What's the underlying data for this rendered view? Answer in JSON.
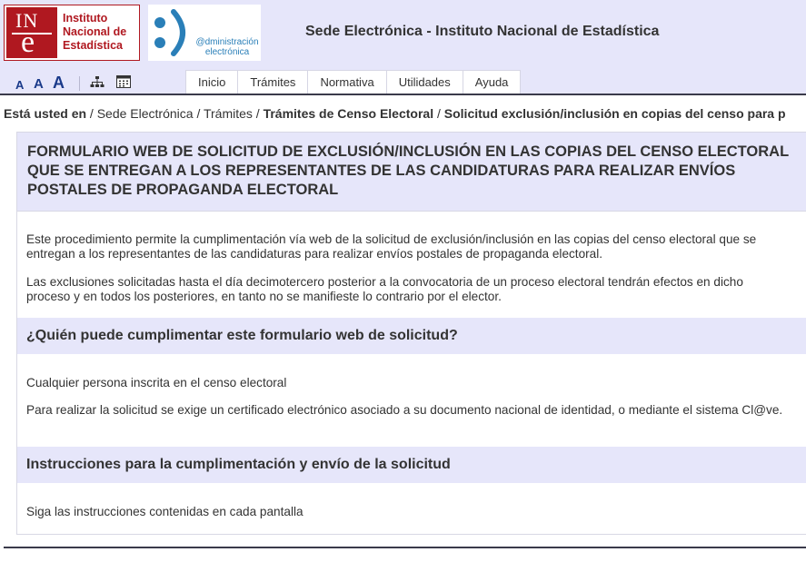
{
  "header": {
    "ine_logo": {
      "mark": "INE",
      "lines": [
        "Instituto",
        "Nacional de",
        "Estadística"
      ],
      "brand_color": "#b01820"
    },
    "admin_logo": {
      "lines": [
        "@dministración",
        "electrónica"
      ],
      "brand_color": "#2a7fb8"
    },
    "site_title": "Sede Electrónica - Instituto Nacional de Estadística",
    "font_sizes": {
      "small": "A",
      "medium": "A",
      "large": "A"
    },
    "icons": [
      "sitemap-icon",
      "calendar-icon"
    ],
    "nav_tabs": [
      "Inicio",
      "Trámites",
      "Normativa",
      "Utilidades",
      "Ayuda"
    ],
    "background": "#e6e6fa"
  },
  "breadcrumb": {
    "lead": "Está usted en",
    "sep": "/",
    "items": [
      "Sede Electrónica",
      "Trámites"
    ],
    "current": [
      "Trámites de Censo Electoral",
      "Solicitud exclusión/inclusión en copias del censo para p"
    ]
  },
  "content": {
    "title": "FORMULARIO WEB DE SOLICITUD DE EXCLUSIÓN/INCLUSIÓN EN LAS COPIAS DEL CENSO ELECTORAL QUE SE ENTREGAN A LOS REPRESENTANTES DE LAS CANDIDATURAS PARA REALIZAR ENVÍOS POSTALES DE PROPAGANDA ELECTORAL",
    "intro": [
      "Este procedimiento permite la cumplimentación vía web de la solicitud de exclusión/inclusión en las copias del censo electoral que se entregan a los representantes de las candidaturas para realizar envíos postales de propaganda electoral.",
      "Las exclusiones solicitadas hasta el día decimotercero posterior a la convocatoria de un proceso electoral tendrán efectos en dicho proceso y en todos los posteriores, en tanto no se manifieste lo contrario por el elector."
    ],
    "sections": [
      {
        "heading": "¿Quién puede cumplimentar este formulario web de solicitud?",
        "paragraphs": [
          "Cualquier persona inscrita en el censo electoral",
          "Para realizar la solicitud se exige un certificado electrónico asociado a su documento nacional de identidad, o mediante el sistema Cl@ve."
        ]
      },
      {
        "heading": "Instrucciones para la cumplimentación y envío de la solicitud",
        "paragraphs": [
          "Siga las instrucciones contenidas en cada pantalla"
        ]
      }
    ],
    "accent_background": "#e6e6fa"
  }
}
